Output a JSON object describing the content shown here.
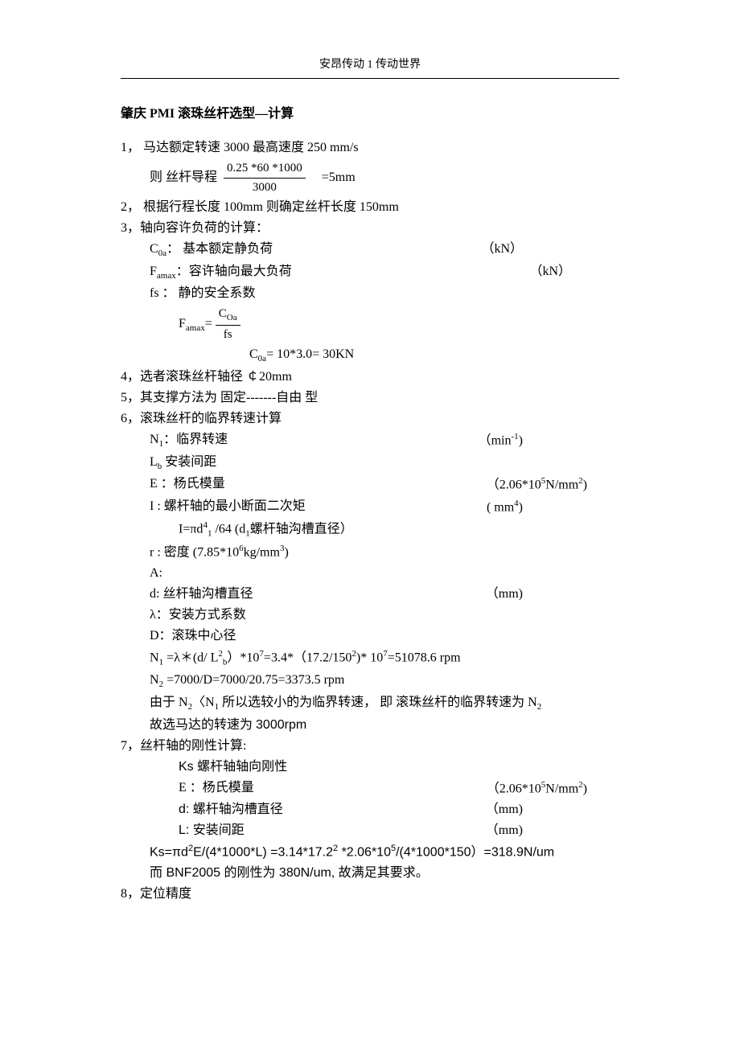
{
  "header": "安昂传动 1 传动世界",
  "title": "肇庆 PMI 滚珠丝杆选型—计算",
  "s1": {
    "prefix": "1， 马达额定转速  3000     最高速度  250 mm/s",
    "lead_label": "则  丝杆导程",
    "lead_num": "0.25 *60 *1000",
    "lead_den": "3000",
    "lead_result": "=5mm"
  },
  "s2": "2， 根据行程长度  100mm  则确定丝杆长度 150mm",
  "s3": {
    "head": "3，轴向容许负荷的计算：",
    "c0a_l": "C",
    "c0a_s": "0a",
    "c0a_t": "：   基本额定静负荷",
    "c0a_u": "（kN）",
    "fmax_l": "F",
    "fmax_s": "amax",
    "fmax_t": "：容许轴向最大负荷",
    "fmax_u": "（kN）",
    "fs_t": "fs   ：  静的安全系数",
    "eq_pre": "F",
    "eq_sub": "amax",
    "eq_eq": "=",
    "eq_num": "C",
    "eq_num_s": "Oa",
    "eq_den": "fs",
    "c0a_val": "C",
    "c0a_val_s": "0a",
    "c0a_val_t": "= 10*3.0= 30KN"
  },
  "s4": "4，选者滚珠丝杆轴径  ￠20mm",
  "s5": "5，其支撑方法为  固定-------自由   型",
  "s6": {
    "head": "6，滚珠丝杆的临界转速计算",
    "n1_l": "N",
    "n1_s": "1",
    "n1_t": "：临界转速",
    "n1_u": "（min",
    "n1_up": "-1",
    "n1_uc": ")",
    "lb_l": "L",
    "lb_s": "b",
    "lb_t": "   安装间距",
    "e_t": "E  ：杨氏模量",
    "e_u": "（2.06*10",
    "e_up": "5",
    "e_uc": "N/mm",
    "e_up2": "2",
    "e_ucc": ")",
    "i_t": "I :    螺杆轴的最小断面二次矩",
    "i_u": "( mm",
    "i_up": "4",
    "i_uc": ")",
    "if_t": "I=πd",
    "if_s": "1",
    "if_up": "4",
    "if_tt": "  /64 (d",
    "if_s2": "1",
    "if_ttt": "螺杆轴沟槽直径）",
    "r_t": "r :  密度  (7.85*10",
    "r_up": "6",
    "r_uc": "kg/mm",
    "r_up2": "3",
    "r_ucc": ")",
    "a_t": "A:",
    "d_t": "d:  丝杆轴沟槽直径",
    "d_u": "（mm)",
    "lam_t": "λ：安装方式系数",
    "dd_t": "D：滚珠中心径",
    "n1eq": "N",
    "n1eq_s": "1",
    "n1eq_t": " =λ＊(d/  L",
    "n1eq_s2": "b",
    "n1eq_up": "2",
    "n1eq_tt": "）*10",
    "n1eq_up2": "7",
    "n1eq_ttt": "=3.4*（17.2/150",
    "n1eq_up3": "2",
    "n1eq_tttt": ")* 10",
    "n1eq_up4": "7",
    "n1eq_ttttt": "=51078.6 rpm",
    "n2eq": "N",
    "n2eq_s": "2",
    "n2eq_t": " =7000/D=7000/20.75=3373.5 rpm",
    "conc1_a": "由于 N",
    "conc1_s1": "2",
    "conc1_b": "〈N",
    "conc1_s2": "1",
    "conc1_c": " 所以选较小的为临界转速， 即  滚珠丝杆的临界转速为 N",
    "conc1_s3": "2",
    "conc2": "故选马达的转速为 ",
    "conc2b": "3000rpm"
  },
  "s7": {
    "head": "7，丝杆轴的刚性计算:",
    "ks_t": "Ks  螺杆轴轴向刚性",
    "e_t": "E  ：杨氏模量",
    "e_u": "（2.06*10",
    "e_up": "5",
    "e_uc": "N/mm",
    "e_up2": "2",
    "e_ucc": ")",
    "d_t": "d:  螺杆轴沟槽直径",
    "d_u": "（mm)",
    "l_t": "L:  安装间距",
    "l_u": "（mm)",
    "ks_eq_a": "Ks=πd",
    "ks_eq_up1": "2",
    "ks_eq_b": "E/(4*1000*L) =3.14*17.2",
    "ks_eq_up2": "2",
    "ks_eq_c": " *2.06*10",
    "ks_eq_up3": "5",
    "ks_eq_d": "/(4*1000*150）=318.9N/um",
    "bnf": "而 BNF2005  的刚性为 380N/um,  故满足其要求。"
  },
  "s8": "8，定位精度"
}
